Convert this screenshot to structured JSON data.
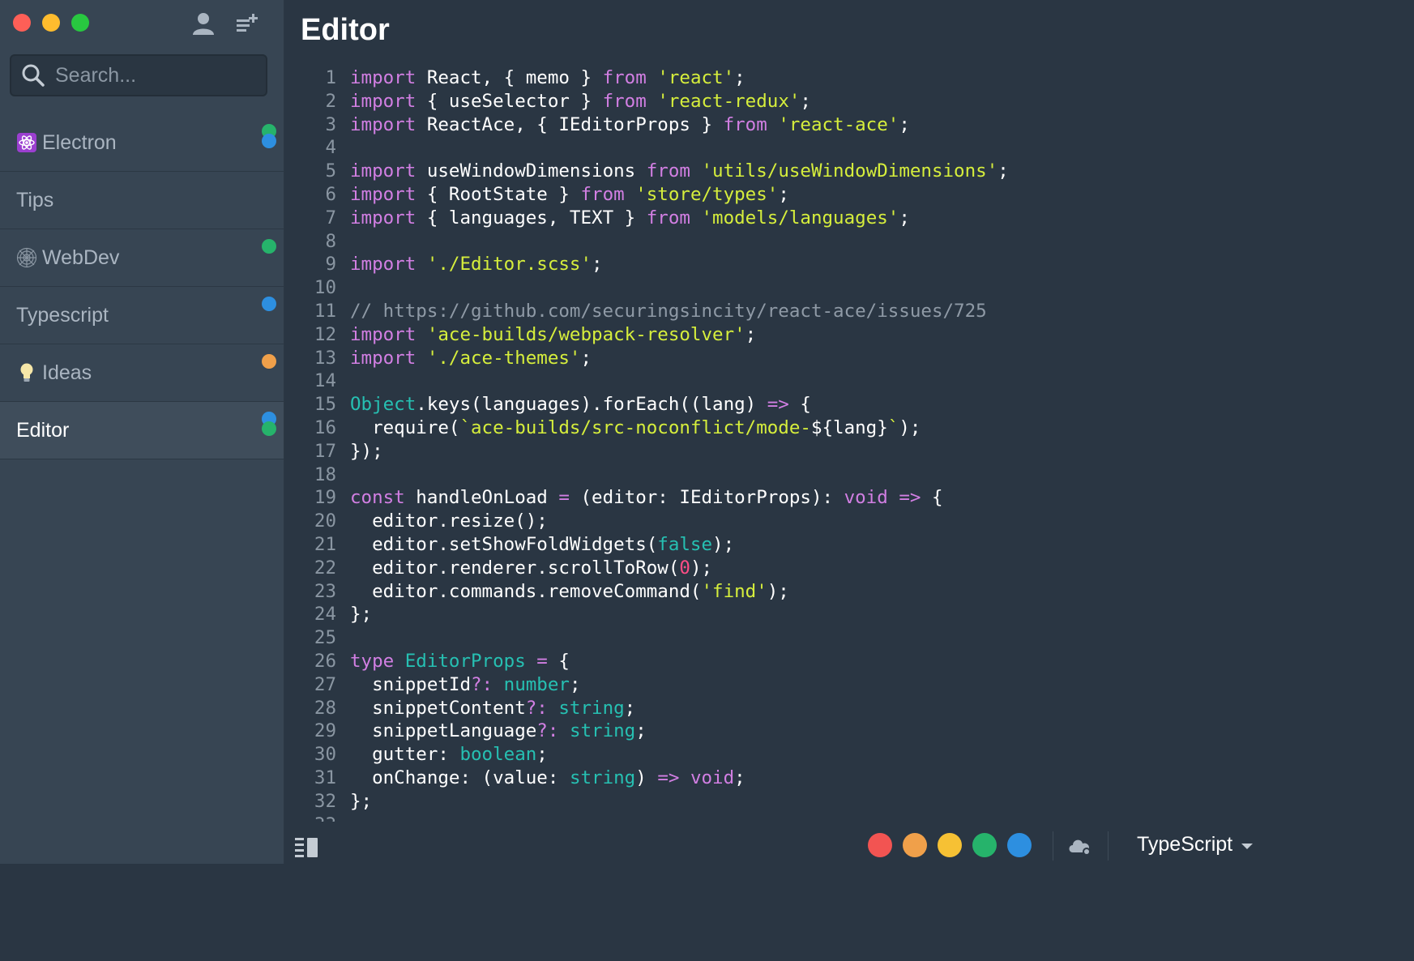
{
  "sidebar": {
    "search_placeholder": "Search...",
    "items": [
      {
        "label": "Electron",
        "icon": "atom-icon",
        "dots": [
          "#26b36b",
          "#2d8fe0"
        ],
        "active": false
      },
      {
        "label": "Tips",
        "icon": "",
        "dots": [],
        "active": false
      },
      {
        "label": "WebDev",
        "icon": "spider-web-icon",
        "dots": [
          "#26b36b"
        ],
        "active": false
      },
      {
        "label": "Typescript",
        "icon": "",
        "dots": [
          "#2d8fe0"
        ],
        "active": false
      },
      {
        "label": "Ideas",
        "icon": "lightbulb-icon",
        "dots": [
          "#f0a04a"
        ],
        "active": false
      },
      {
        "label": "Editor",
        "icon": "",
        "dots": [
          "#2d8fe0",
          "#26b36b"
        ],
        "active": true
      }
    ]
  },
  "editor": {
    "title": "Editor",
    "language": "TypeScript",
    "color_tags": [
      "#f25452",
      "#f0a04a",
      "#f6c134",
      "#26b36b",
      "#2d8fe0"
    ],
    "lines": [
      [
        [
          "kw",
          "import"
        ],
        [
          "p",
          " React, { memo } "
        ],
        [
          "kw",
          "from"
        ],
        [
          "p",
          " "
        ],
        [
          "s",
          "'react'"
        ],
        [
          "p",
          ";"
        ]
      ],
      [
        [
          "kw",
          "import"
        ],
        [
          "p",
          " { useSelector } "
        ],
        [
          "kw",
          "from"
        ],
        [
          "p",
          " "
        ],
        [
          "s",
          "'react-redux'"
        ],
        [
          "p",
          ";"
        ]
      ],
      [
        [
          "kw",
          "import"
        ],
        [
          "p",
          " ReactAce, { IEditorProps } "
        ],
        [
          "kw",
          "from"
        ],
        [
          "p",
          " "
        ],
        [
          "s",
          "'react-ace'"
        ],
        [
          "p",
          ";"
        ]
      ],
      [],
      [
        [
          "kw",
          "import"
        ],
        [
          "p",
          " useWindowDimensions "
        ],
        [
          "kw",
          "from"
        ],
        [
          "p",
          " "
        ],
        [
          "s",
          "'utils/useWindowDimensions'"
        ],
        [
          "p",
          ";"
        ]
      ],
      [
        [
          "kw",
          "import"
        ],
        [
          "p",
          " { RootState } "
        ],
        [
          "kw",
          "from"
        ],
        [
          "p",
          " "
        ],
        [
          "s",
          "'store/types'"
        ],
        [
          "p",
          ";"
        ]
      ],
      [
        [
          "kw",
          "import"
        ],
        [
          "p",
          " { languages, TEXT } "
        ],
        [
          "kw",
          "from"
        ],
        [
          "p",
          " "
        ],
        [
          "s",
          "'models/languages'"
        ],
        [
          "p",
          ";"
        ]
      ],
      [],
      [
        [
          "kw",
          "import"
        ],
        [
          "p",
          " "
        ],
        [
          "s",
          "'./Editor.scss'"
        ],
        [
          "p",
          ";"
        ]
      ],
      [],
      [
        [
          "c",
          "// https://github.com/securingsincity/react-ace/issues/725"
        ]
      ],
      [
        [
          "kw",
          "import"
        ],
        [
          "p",
          " "
        ],
        [
          "s",
          "'ace-builds/webpack-resolver'"
        ],
        [
          "p",
          ";"
        ]
      ],
      [
        [
          "kw",
          "import"
        ],
        [
          "p",
          " "
        ],
        [
          "s",
          "'./ace-themes'"
        ],
        [
          "p",
          ";"
        ]
      ],
      [],
      [
        [
          "t",
          "Object"
        ],
        [
          "p",
          ".keys(languages).forEach((lang) "
        ],
        [
          "kw",
          "=>"
        ],
        [
          "p",
          " {"
        ]
      ],
      [
        [
          "p",
          "  require("
        ],
        [
          "s",
          "`ace-builds/src-noconflict/mode-"
        ],
        [
          "p",
          "${lang}"
        ],
        [
          "s",
          "`"
        ],
        [
          "p",
          ");"
        ]
      ],
      [
        [
          "p",
          "});"
        ]
      ],
      [],
      [
        [
          "kw",
          "const"
        ],
        [
          "p",
          " handleOnLoad "
        ],
        [
          "kw",
          "="
        ],
        [
          "p",
          " (editor: IEditorProps): "
        ],
        [
          "kw",
          "void"
        ],
        [
          "p",
          " "
        ],
        [
          "kw",
          "=>"
        ],
        [
          "p",
          " {"
        ]
      ],
      [
        [
          "p",
          "  editor.resize();"
        ]
      ],
      [
        [
          "p",
          "  editor.setShowFoldWidgets("
        ],
        [
          "t",
          "false"
        ],
        [
          "p",
          ");"
        ]
      ],
      [
        [
          "p",
          "  editor.renderer.scrollToRow("
        ],
        [
          "n",
          "0"
        ],
        [
          "p",
          ");"
        ]
      ],
      [
        [
          "p",
          "  editor.commands.removeCommand("
        ],
        [
          "s",
          "'find'"
        ],
        [
          "p",
          ");"
        ]
      ],
      [
        [
          "p",
          "};"
        ]
      ],
      [],
      [
        [
          "kw",
          "type"
        ],
        [
          "p",
          " "
        ],
        [
          "t",
          "EditorProps"
        ],
        [
          "p",
          " "
        ],
        [
          "kw",
          "="
        ],
        [
          "p",
          " {"
        ]
      ],
      [
        [
          "p",
          "  snippetId"
        ],
        [
          "kw",
          "?:"
        ],
        [
          "p",
          " "
        ],
        [
          "t",
          "number"
        ],
        [
          "p",
          ";"
        ]
      ],
      [
        [
          "p",
          "  snippetContent"
        ],
        [
          "kw",
          "?:"
        ],
        [
          "p",
          " "
        ],
        [
          "t",
          "string"
        ],
        [
          "p",
          ";"
        ]
      ],
      [
        [
          "p",
          "  snippetLanguage"
        ],
        [
          "kw",
          "?:"
        ],
        [
          "p",
          " "
        ],
        [
          "t",
          "string"
        ],
        [
          "p",
          ";"
        ]
      ],
      [
        [
          "p",
          "  gutter: "
        ],
        [
          "t",
          "boolean"
        ],
        [
          "p",
          ";"
        ]
      ],
      [
        [
          "p",
          "  onChange: (value: "
        ],
        [
          "t",
          "string"
        ],
        [
          "p",
          ") "
        ],
        [
          "kw",
          "=>"
        ],
        [
          "p",
          " "
        ],
        [
          "kw",
          "void"
        ],
        [
          "p",
          ";"
        ]
      ],
      [
        [
          "p",
          "};"
        ]
      ],
      []
    ]
  }
}
